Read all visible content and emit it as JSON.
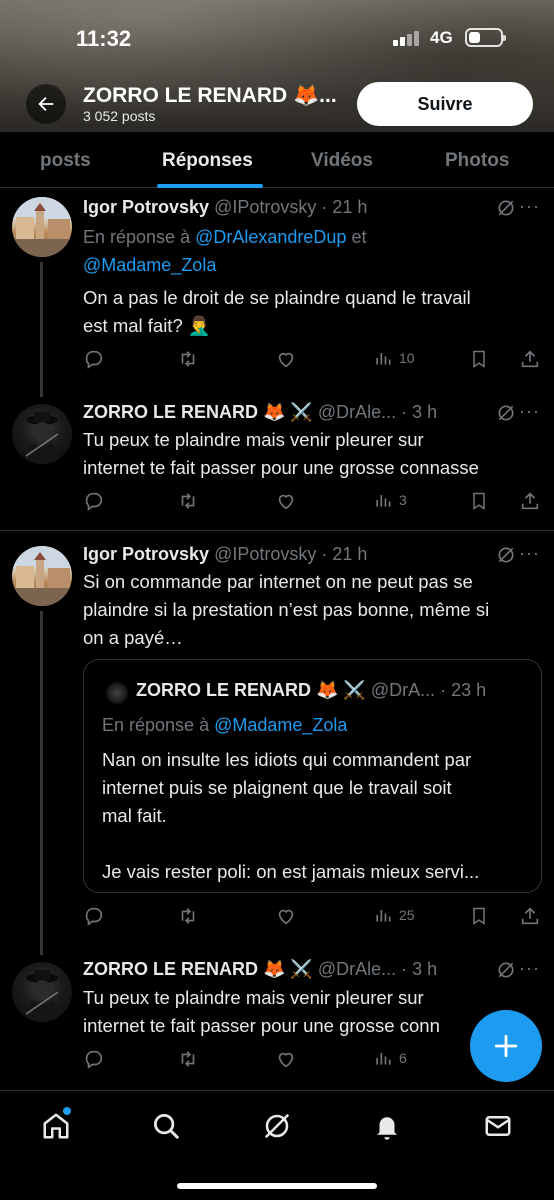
{
  "status_bar": {
    "time": "11:32",
    "network": "4G"
  },
  "header": {
    "name": "ZORRO LE RENARD 🦊...",
    "posts_count": "3 052 posts",
    "follow_label": "Suivre"
  },
  "tabs": [
    {
      "label": "posts"
    },
    {
      "label": "Réponses"
    },
    {
      "label": "Vidéos"
    },
    {
      "label": "Photos"
    }
  ],
  "tweets": [
    {
      "name": "Igor Potrovsky",
      "handle": "@IPotrovsky",
      "time": "· 21 h",
      "reply_prefix": "En réponse à",
      "reply_user1": "@DrAlexandreDup",
      "reply_and": "et",
      "reply_user2": "@Madame_Zola",
      "text_line1": "On a pas le droit de se plaindre quand le travail",
      "text_line2": "est mal fait? 🤦‍♂️",
      "views": "10"
    },
    {
      "name": "ZORRO LE RENARD 🦊 ⚔️",
      "handle": "@DrAle...",
      "time": "· 3 h",
      "text_line1": "Tu peux te plaindre mais venir pleurer sur",
      "text_line2": "internet te fait passer pour une grosse connasse",
      "views": "3"
    },
    {
      "name": "Igor Potrovsky",
      "handle": "@IPotrovsky",
      "time": "· 21 h",
      "text_line1": "Si on commande par internet on ne peut pas se",
      "text_line2": "plaindre si la prestation n’est pas bonne, même si",
      "text_line3": "on a payé…",
      "views": "25",
      "quote": {
        "name": "ZORRO LE RENARD 🦊 ⚔️",
        "handle": "@DrA...",
        "time": "· 23 h",
        "reply_prefix": "En réponse à",
        "reply_user": "@Madame_Zola",
        "text_line1": "Nan on insulte les idiots qui commandent par",
        "text_line2": "internet puis se plaignent que le travail soit",
        "text_line3": "mal fait.",
        "text_line4": "Je vais rester poli: on est jamais mieux servi..."
      }
    },
    {
      "name": "ZORRO LE RENARD 🦊 ⚔️",
      "handle": "@DrAle...",
      "time": "· 3 h",
      "text_line1": "Tu peux te plaindre mais venir pleurer sur",
      "text_line2": "internet te fait passer pour une grosse conn",
      "views": "6"
    }
  ],
  "icons": {
    "back": "arrow-left-icon",
    "reply": "reply-icon",
    "retweet": "retweet-icon",
    "like": "heart-icon",
    "views": "bar-chart-icon",
    "bookmark": "bookmark-icon",
    "share": "share-icon",
    "grok": "grok-icon",
    "home": "home-icon",
    "search": "search-icon",
    "bell": "bell-icon",
    "mail": "mail-icon",
    "compose": "plus-icon"
  },
  "colors": {
    "accent": "#1d9bf0",
    "muted": "#71767b",
    "text": "#e7e9ea",
    "background": "#000000"
  }
}
